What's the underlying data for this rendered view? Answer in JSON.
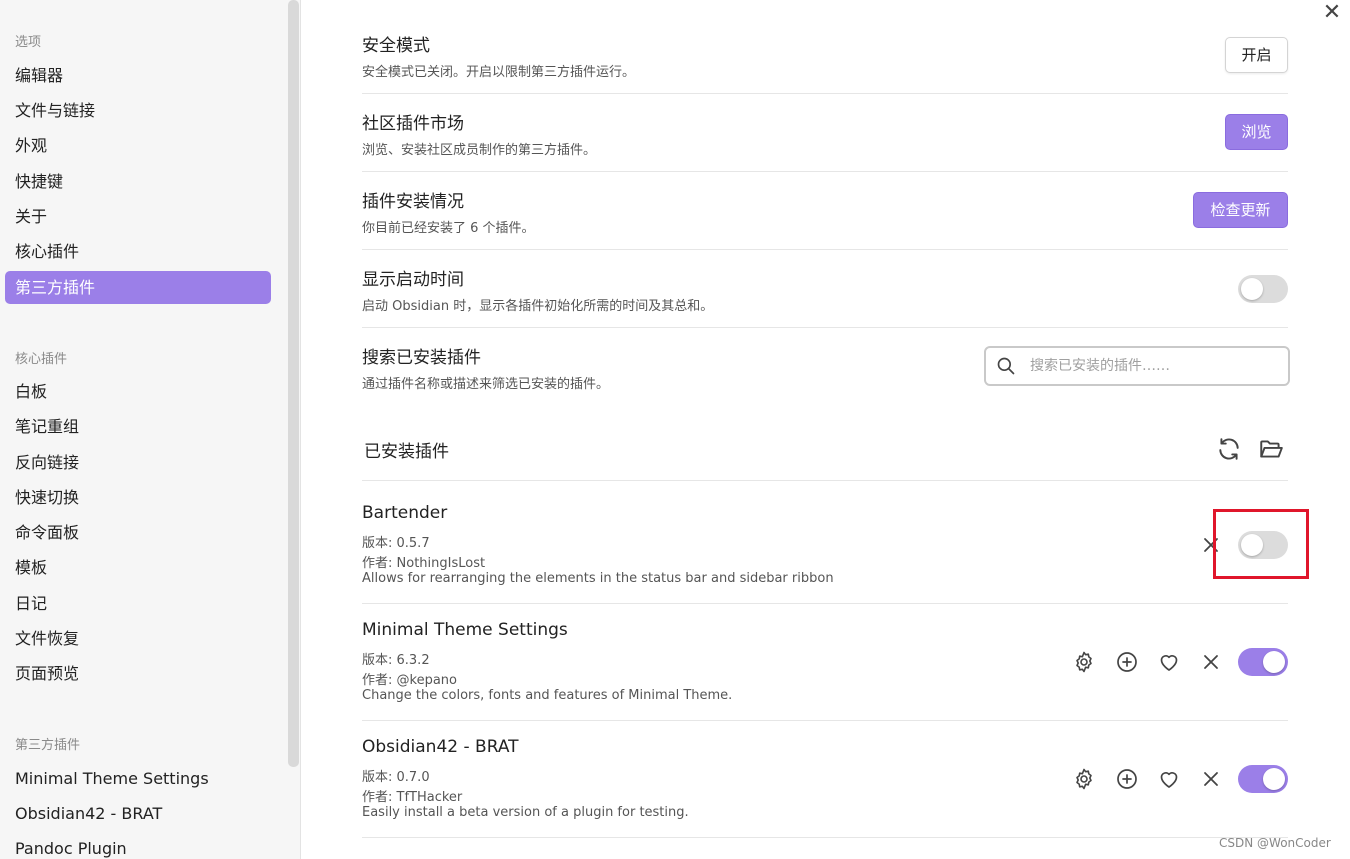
{
  "sidebar": {
    "options_header": "选项",
    "options": [
      "编辑器",
      "文件与链接",
      "外观",
      "快捷键",
      "关于",
      "核心插件",
      "第三方插件"
    ],
    "active_option": "第三方插件",
    "core_header": "核心插件",
    "core_plugins": [
      "白板",
      "笔记重组",
      "反向链接",
      "快速切换",
      "命令面板",
      "模板",
      "日记",
      "文件恢复",
      "页面预览"
    ],
    "third_header": "第三方插件",
    "third_plugins": [
      "Minimal Theme Settings",
      "Obsidian42 - BRAT",
      "Pandoc Plugin"
    ]
  },
  "close_icon": "close-icon",
  "settings": {
    "safe_mode": {
      "title": "安全模式",
      "desc": "安全模式已关闭。开启以限制第三方插件运行。",
      "button": "开启"
    },
    "market": {
      "title": "社区插件市场",
      "desc": "浏览、安装社区成员制作的第三方插件。",
      "button": "浏览"
    },
    "installed": {
      "title": "插件安装情况",
      "desc": "你目前已经安装了 6 个插件。",
      "button": "检查更新"
    },
    "startup": {
      "title": "显示启动时间",
      "desc": "启动 Obsidian 时，显示各插件初始化所需的时间及其总和。",
      "enabled": false
    },
    "search": {
      "title": "搜索已安装插件",
      "desc": "通过插件名称或描述来筛选已安装的插件。",
      "placeholder": "搜索已安装的插件……"
    }
  },
  "installed_section": {
    "title": "已安装插件",
    "icons": [
      "refresh-icon",
      "folder-open-icon"
    ]
  },
  "plugins": [
    {
      "name": "Bartender",
      "version": "版本: 0.5.7",
      "author": "作者: NothingIsLost",
      "desc": "Allows for rearranging the elements in the status bar and sidebar ribbon",
      "enabled": false
    },
    {
      "name": "Minimal Theme Settings",
      "version": "版本: 6.3.2",
      "author": "作者: @kepano",
      "desc": "Change the colors, fonts and features of Minimal Theme.",
      "enabled": true
    },
    {
      "name": "Obsidian42 - BRAT",
      "version": "版本: 0.7.0",
      "author": "作者: TfTHacker",
      "desc": "Easily install a beta version of a plugin for testing.",
      "enabled": true
    }
  ],
  "watermark": "CSDN @WonCoder",
  "colors": {
    "accent": "#9b7fe8",
    "highlight": "#e0162b",
    "sidebar_bg": "#f6f6f6"
  }
}
